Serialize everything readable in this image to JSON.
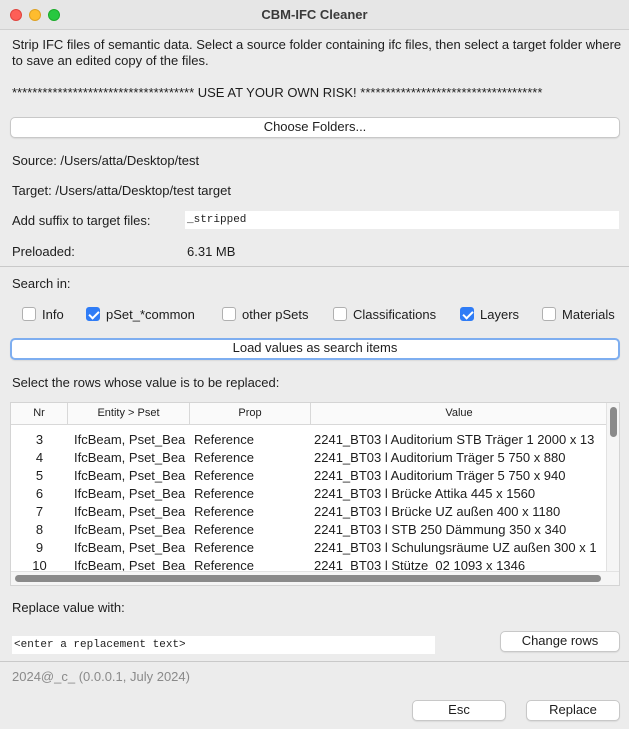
{
  "window": {
    "title": "CBM-IFC Cleaner"
  },
  "intro": {
    "description": "Strip IFC files of semantic data. Select a source folder containing ifc files, then select a target folder where to save an edited copy of the files.",
    "warning": "************************************ USE AT YOUR OWN RISK! ************************************"
  },
  "buttons": {
    "choose_folders": "Choose Folders...",
    "load_values": "Load values as search items",
    "change_rows": "Change rows",
    "esc": "Esc",
    "replace": "Replace"
  },
  "paths": {
    "source": "Source: /Users/atta/Desktop/test",
    "target": "Target: /Users/atta/Desktop/test target"
  },
  "suffix": {
    "label": "Add suffix to target files:",
    "value": "_stripped"
  },
  "preloaded": {
    "label": "Preloaded:",
    "value": "6.31 MB"
  },
  "search": {
    "label": "Search in:",
    "options": [
      {
        "label": "Info",
        "checked": false
      },
      {
        "label": "pSet_*common",
        "checked": true
      },
      {
        "label": "other pSets",
        "checked": false
      },
      {
        "label": "Classifications",
        "checked": false
      },
      {
        "label": "Layers",
        "checked": true
      },
      {
        "label": "Materials",
        "checked": false
      }
    ]
  },
  "table": {
    "instruction": "Select the rows whose value is to be replaced:",
    "columns": [
      "Nr",
      "Entity > Pset",
      "Prop",
      "Value"
    ],
    "rows": [
      [
        "3",
        "IfcBeam, Pset_Bea",
        "Reference",
        "2241_BT03 l Auditorium STB Träger 1 2000 x 13"
      ],
      [
        "4",
        "IfcBeam, Pset_Bea",
        "Reference",
        "2241_BT03 l Auditorium Träger 5 750 x 880"
      ],
      [
        "5",
        "IfcBeam, Pset_Bea",
        "Reference",
        "2241_BT03 l Auditorium Träger 5 750 x 940"
      ],
      [
        "6",
        "IfcBeam, Pset_Bea",
        "Reference",
        "2241_BT03 l Brücke Attika 445 x 1560"
      ],
      [
        "7",
        "IfcBeam, Pset_Bea",
        "Reference",
        "2241_BT03 l Brücke UZ außen 400 x 1180"
      ],
      [
        "8",
        "IfcBeam, Pset_Bea",
        "Reference",
        "2241_BT03 l STB 250 Dämmung 350 x 340"
      ],
      [
        "9",
        "IfcBeam, Pset_Bea",
        "Reference",
        "2241_BT03 l Schulungsräume UZ außen 300 x 1"
      ],
      [
        "10",
        "IfcBeam, Pset_Bea",
        "Reference",
        "2241_BT03 l Stütze_02 1093 x 1346"
      ]
    ]
  },
  "replace": {
    "label": "Replace value with:",
    "placeholder": "<enter a replacement text>"
  },
  "footer": {
    "version": "2024@_c_ (0.0.0.1, July 2024)"
  },
  "colors": {
    "accent": "#2f7cf6",
    "focus_ring": "#7eaef0"
  }
}
